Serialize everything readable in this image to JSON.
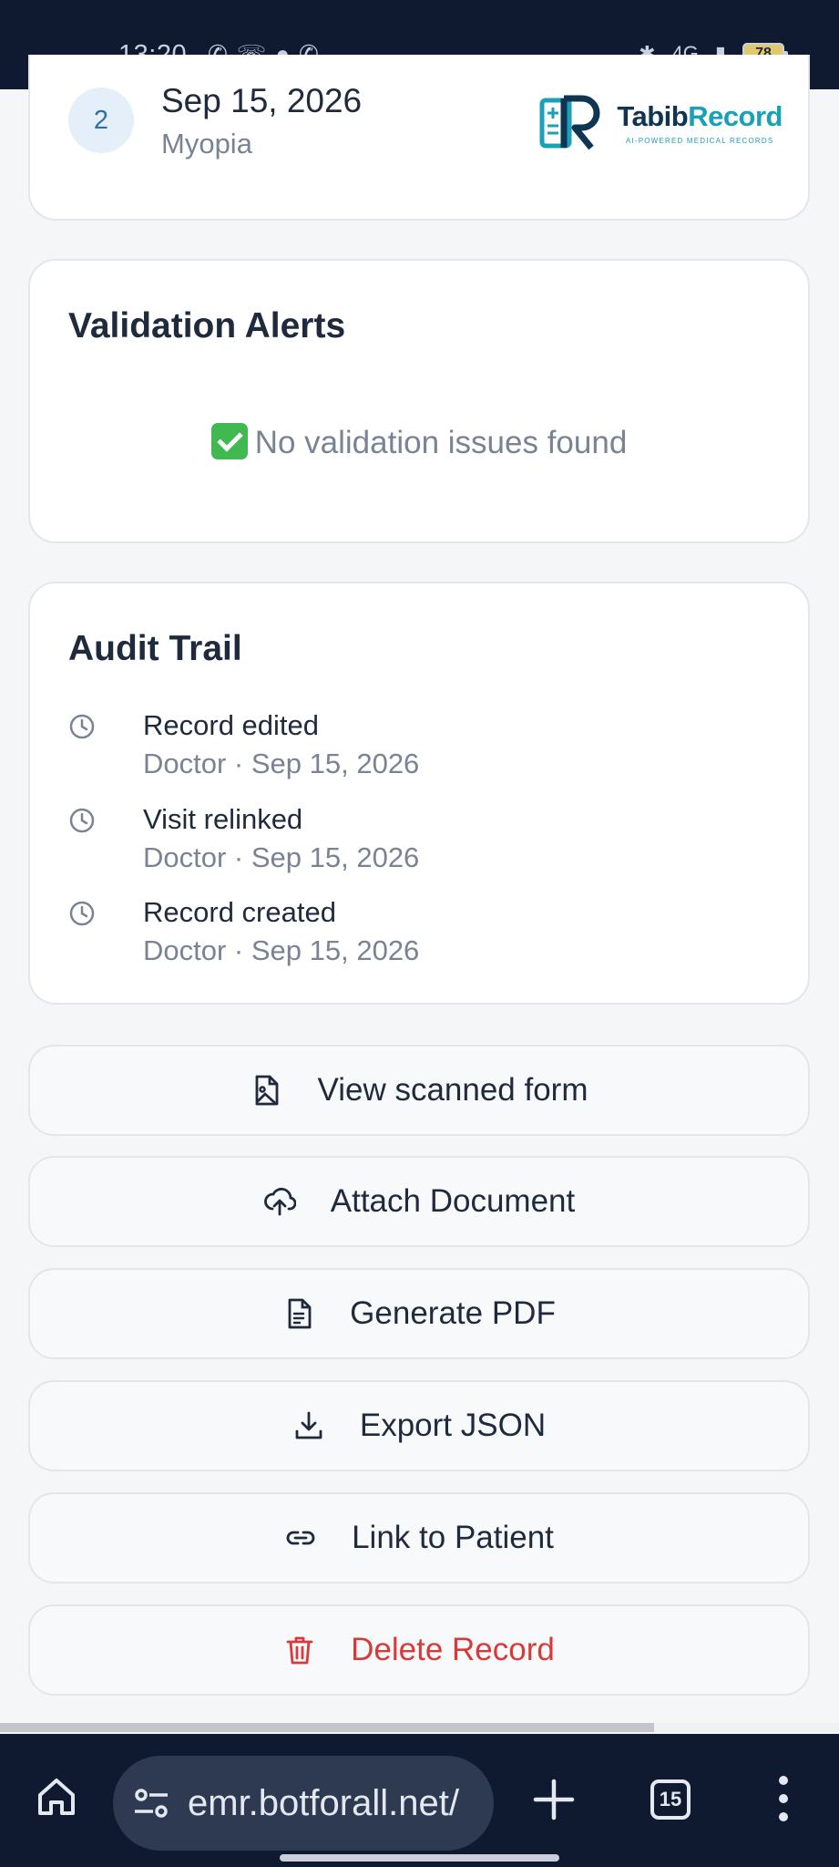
{
  "status_bar": {
    "time": "13:20",
    "network": "4G",
    "battery": "78"
  },
  "visit": {
    "number": "2",
    "date": "Sep 15, 2026",
    "diagnosis": "Myopia"
  },
  "logo": {
    "name_part1": "Tabib",
    "name_part2": "Record",
    "tagline": "AI-POWERED MEDICAL RECORDS"
  },
  "validation": {
    "title": "Validation Alerts",
    "message": "No validation issues found"
  },
  "audit": {
    "title": "Audit Trail",
    "items": [
      {
        "action": "Record edited",
        "meta": "Doctor · Sep 15, 2026"
      },
      {
        "action": "Visit relinked",
        "meta": "Doctor · Sep 15, 2026"
      },
      {
        "action": "Record created",
        "meta": "Doctor · Sep 15, 2026"
      }
    ]
  },
  "actions": {
    "view_scanned": "View scanned form",
    "attach": "Attach Document",
    "pdf": "Generate PDF",
    "export": "Export JSON",
    "link": "Link to Patient",
    "delete": "Delete Record"
  },
  "browser": {
    "url": "emr.botforall.net/",
    "tab_count": "15"
  },
  "colors": {
    "danger": "#d83a3a",
    "brand_dark": "#0e3552",
    "brand_teal": "#1aa0b8",
    "bar_bg": "#0f1a30"
  }
}
